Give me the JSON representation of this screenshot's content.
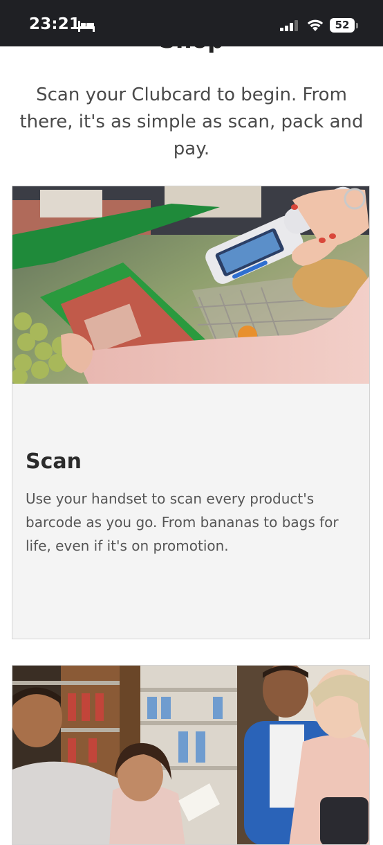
{
  "status_bar": {
    "time": "23:21",
    "battery": "52",
    "icons": [
      "bed-icon",
      "signal-icon",
      "wifi-icon",
      "battery-icon"
    ]
  },
  "page": {
    "heading_partial": "Shop",
    "intro": "Scan your Clubcard to begin. From there, it's as simple as scan, pack and pay."
  },
  "cards": [
    {
      "image_description_icon": "shopper-scanning-handset-image",
      "title": "Scan",
      "text": "Use your handset to scan every product's barcode as you go. From bananas to bags for life, even if it's on promotion."
    },
    {
      "image_description_icon": "family-shopping-image"
    }
  ],
  "colors": {
    "status_bar_bg": "#1f2024",
    "card_bg": "#f4f4f4",
    "accent_green": "#2e9a3d",
    "text": "#4a4a4a"
  }
}
